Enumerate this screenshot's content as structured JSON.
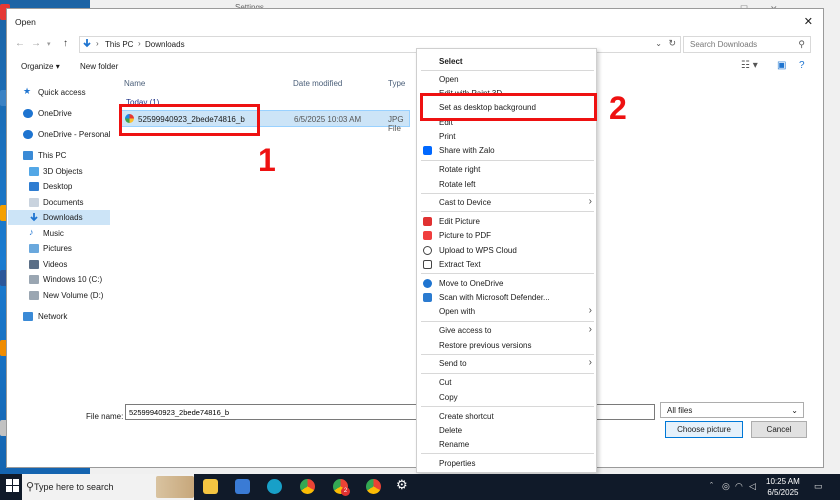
{
  "background": {
    "settings_title": "Settings"
  },
  "dialog": {
    "title": "Open",
    "breadcrumb": [
      "This PC",
      "Downloads"
    ],
    "search_placeholder": "Search Downloads",
    "toolbar": {
      "organize": "Organize",
      "new_folder": "New folder"
    },
    "nav": [
      {
        "label": "Quick access",
        "icon": "star-icon"
      },
      {
        "label": "OneDrive",
        "icon": "cloud-icon"
      },
      {
        "label": "OneDrive - Personal",
        "icon": "cloud-icon"
      },
      {
        "label": "This PC",
        "icon": "computer-icon"
      },
      {
        "label": "3D Objects",
        "icon": "cube-icon"
      },
      {
        "label": "Desktop",
        "icon": "desktop-folder-icon"
      },
      {
        "label": "Documents",
        "icon": "documents-icon"
      },
      {
        "label": "Downloads",
        "icon": "download-icon"
      },
      {
        "label": "Music",
        "icon": "music-icon"
      },
      {
        "label": "Pictures",
        "icon": "pictures-icon"
      },
      {
        "label": "Videos",
        "icon": "videos-icon"
      },
      {
        "label": "Windows 10 (C:)",
        "icon": "drive-icon"
      },
      {
        "label": "New Volume (D:)",
        "icon": "drive-icon"
      },
      {
        "label": "Network",
        "icon": "network-icon"
      }
    ],
    "columns": {
      "name": "Name",
      "date": "Date modified",
      "type": "Type"
    },
    "group": "Today (1)",
    "file": {
      "name": "52599940923_2bede74816_b",
      "date": "6/5/2025 10:03 AM",
      "type": "JPG File"
    },
    "filename_label": "File name:",
    "filename_value": "52599940923_2bede74816_b",
    "filter": "All files",
    "choose_button": "Choose picture",
    "cancel_button": "Cancel"
  },
  "context_menu": {
    "items": [
      {
        "label": "Select",
        "bold": true
      },
      {
        "label": "Open"
      },
      {
        "label": "Edit with Paint 3D"
      },
      {
        "label": "Set as desktop background"
      },
      {
        "label": "Edit"
      },
      {
        "label": "Print"
      },
      {
        "label": "Share with Zalo"
      },
      {
        "label": "Rotate right"
      },
      {
        "label": "Rotate left"
      },
      {
        "label": "Cast to Device"
      },
      {
        "label": "Edit Picture"
      },
      {
        "label": "Picture to PDF"
      },
      {
        "label": "Upload to WPS Cloud"
      },
      {
        "label": "Extract Text"
      },
      {
        "label": "Move to OneDrive"
      },
      {
        "label": "Scan with Microsoft Defender..."
      },
      {
        "label": "Open with"
      },
      {
        "label": "Give access to"
      },
      {
        "label": "Restore previous versions"
      },
      {
        "label": "Send to"
      },
      {
        "label": "Cut"
      },
      {
        "label": "Copy"
      },
      {
        "label": "Create shortcut"
      },
      {
        "label": "Delete"
      },
      {
        "label": "Rename"
      },
      {
        "label": "Properties"
      }
    ]
  },
  "annotations": {
    "first": "1",
    "second": "2"
  },
  "taskbar": {
    "search_placeholder": "Type here to search",
    "time": "10:25 AM",
    "date": "6/5/2025",
    "badge": "2"
  },
  "colors": {
    "accent": "#0078d7",
    "annotation": "#ee1111",
    "selection": "#cce4f7"
  }
}
